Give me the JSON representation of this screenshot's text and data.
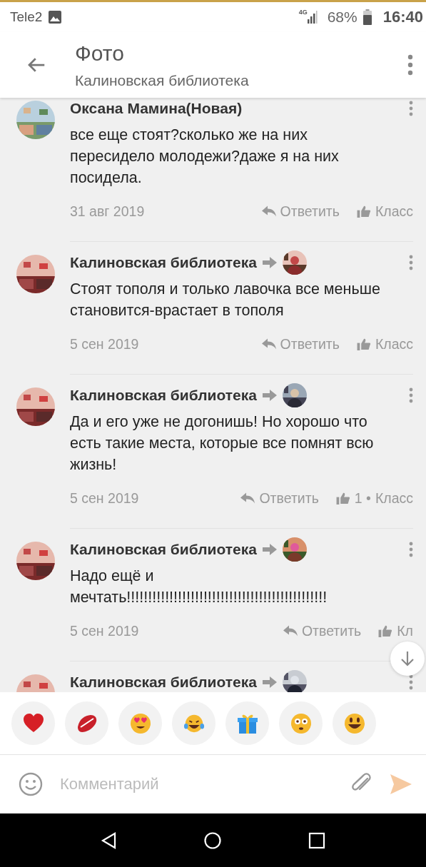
{
  "status_bar": {
    "carrier": "Tele2",
    "network": "4G",
    "battery": "68%",
    "time": "16:40"
  },
  "header": {
    "title": "Фото",
    "subtitle": "Калиновская библиотека"
  },
  "comments": [
    {
      "author": "Оксана Мамина(Новая)",
      "has_recipient": false,
      "text": "все еще стоят?сколько же на них пересидело молодежи?даже я на них посидела.",
      "date": "31 авг 2019",
      "reply": "Ответить",
      "like_label": "Класс"
    },
    {
      "author": "Калиновская библиотека",
      "has_recipient": true,
      "text": "Стоят тополя и только лавочка все меньше становится-врастает в тополя",
      "date": "5 сен 2019",
      "reply": "Ответить",
      "like_label": "Класс"
    },
    {
      "author": "Калиновская библиотека",
      "has_recipient": true,
      "text": "Да и его уже не догонишь! Но хорошо что есть такие места, которые все помнят всю жизнь!",
      "date": "5 сен 2019",
      "reply": "Ответить",
      "likes": "1 •",
      "like_label": "Класс"
    },
    {
      "author": "Калиновская библиотека",
      "has_recipient": true,
      "text": "Надо ещё и мечтать!!!!!!!!!!!!!!!!!!!!!!!!!!!!!!!!!!!!!!!!!!!!!!!",
      "date": "5 сен 2019",
      "reply": "Ответить",
      "like_label": "Кл"
    },
    {
      "author": "Калиновская библиотека",
      "has_recipient": true
    }
  ],
  "reactions": [
    {
      "kind": "heart"
    },
    {
      "kind": "kiss"
    },
    {
      "kind": "heart-eyes"
    },
    {
      "kind": "tears-of-joy"
    },
    {
      "kind": "gift"
    },
    {
      "kind": "flushed"
    },
    {
      "kind": "smile"
    }
  ],
  "composer": {
    "placeholder": "Комментарий"
  }
}
